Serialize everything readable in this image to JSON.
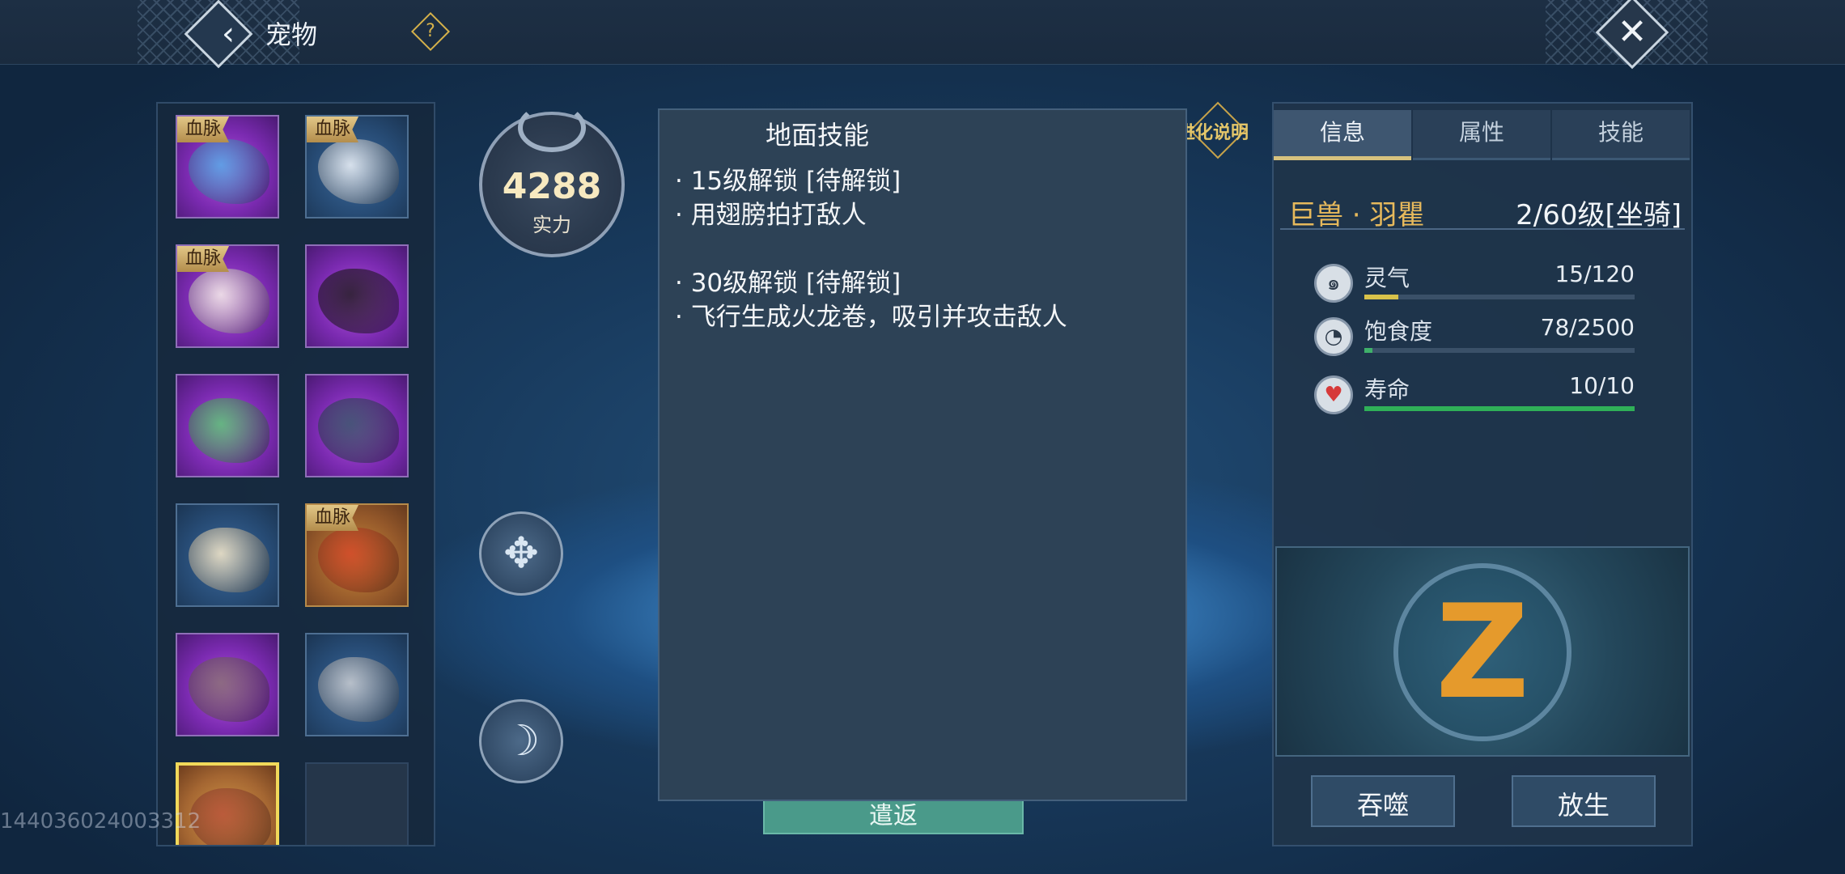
{
  "header": {
    "title": "宠物",
    "help_label": "?",
    "back_icon": "back-chevron-icon",
    "close_icon": "close-x-icon"
  },
  "pets": [
    {
      "tag": "血脉",
      "theme": "purple",
      "art_color": "#5aa5e6"
    },
    {
      "tag": "血脉",
      "theme": "blue",
      "art_color": "#e8eef5"
    },
    {
      "tag": "血脉",
      "theme": "purple",
      "art_color": "#f2e8e8"
    },
    {
      "tag": "",
      "theme": "purple",
      "art_color": "#2a1f2e"
    },
    {
      "tag": "",
      "theme": "purple",
      "art_color": "#5fbf7a"
    },
    {
      "tag": "",
      "theme": "purple",
      "art_color": "#3e5470"
    },
    {
      "tag": "",
      "theme": "blue",
      "art_color": "#f0e4c8"
    },
    {
      "tag": "血脉",
      "theme": "orange",
      "art_color": "#d24b2a"
    },
    {
      "tag": "",
      "theme": "purple",
      "art_color": "#8a6d7a"
    },
    {
      "tag": "",
      "theme": "blue",
      "art_color": "#c5c9cf"
    },
    {
      "tag": "",
      "theme": "selected",
      "art_color": "#b8553a"
    },
    {
      "tag": "",
      "theme": "empty",
      "art_color": ""
    }
  ],
  "footer_id": "144036024003312",
  "power": {
    "value": "4288",
    "label": "实力"
  },
  "evolution_link": "进化说明",
  "release_button": "遣返",
  "skill_popup": {
    "title": "地面技能",
    "lines": [
      "· 15级解锁  [待解锁]",
      "· 用翅膀拍打敌人",
      "· 30级解锁  [待解锁]",
      "· 飞行生成火龙卷，吸引并攻击敌人"
    ]
  },
  "tabs": [
    {
      "label": "信息",
      "active": true
    },
    {
      "label": "属性",
      "active": false
    },
    {
      "label": "技能",
      "active": false
    }
  ],
  "pet_info": {
    "name": "巨兽 · 羽瞿",
    "level": "2/60级[坐骑]"
  },
  "stats": [
    {
      "label": "灵气",
      "value": "15/120",
      "fill": 0.125,
      "color": "#d8c24a",
      "icon": "spirit-swirl-icon"
    },
    {
      "label": "饱食度",
      "value": "78/2500",
      "fill": 0.031,
      "color": "#3fb06a",
      "icon": "stomach-icon"
    },
    {
      "label": "寿命",
      "value": "10/10",
      "fill": 1.0,
      "color": "#2fb058",
      "icon": "heart-icon"
    }
  ],
  "emblem_glyph": "Z",
  "actions": {
    "devour": "吞噬",
    "release": "放生"
  },
  "skill_glyphs": [
    "✥",
    "☽"
  ]
}
